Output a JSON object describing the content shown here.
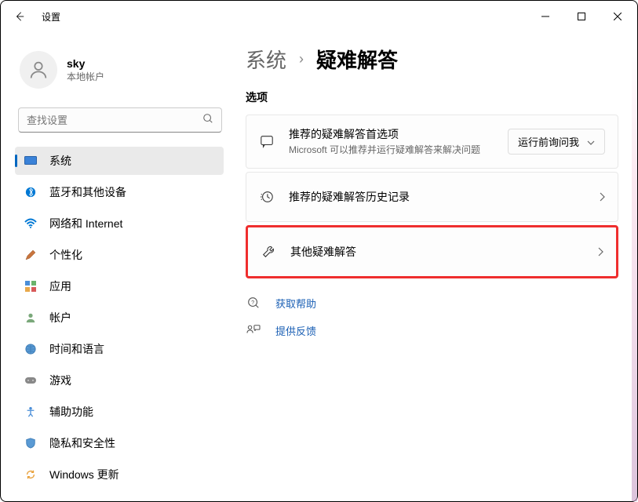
{
  "titlebar": {
    "title": "设置"
  },
  "profile": {
    "username": "sky",
    "accountType": "本地帐户"
  },
  "search": {
    "placeholder": "查找设置"
  },
  "nav": {
    "items": [
      {
        "label": "系统",
        "active": true
      },
      {
        "label": "蓝牙和其他设备"
      },
      {
        "label": "网络和 Internet"
      },
      {
        "label": "个性化"
      },
      {
        "label": "应用"
      },
      {
        "label": "帐户"
      },
      {
        "label": "时间和语言"
      },
      {
        "label": "游戏"
      },
      {
        "label": "辅助功能"
      },
      {
        "label": "隐私和安全性"
      },
      {
        "label": "Windows 更新"
      }
    ]
  },
  "breadcrumb": {
    "parent": "系统",
    "current": "疑难解答"
  },
  "main": {
    "sectionLabel": "选项",
    "cards": {
      "recommended": {
        "title": "推荐的疑难解答首选项",
        "desc": "Microsoft 可以推荐并运行疑难解答来解决问题",
        "dropdown": "运行前询问我"
      },
      "history": {
        "title": "推荐的疑难解答历史记录"
      },
      "other": {
        "title": "其他疑难解答"
      }
    },
    "help": {
      "getHelp": "获取帮助",
      "feedback": "提供反馈"
    }
  }
}
